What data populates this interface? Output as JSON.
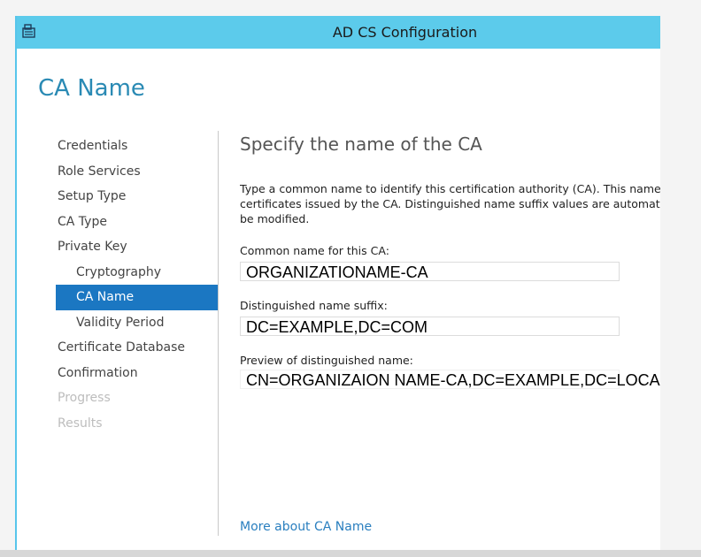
{
  "window": {
    "title": "AD CS Configuration",
    "app_icon": "server-icon"
  },
  "page": {
    "title": "CA Name"
  },
  "nav": {
    "items": [
      {
        "label": "Credentials",
        "state": "normal"
      },
      {
        "label": "Role Services",
        "state": "normal"
      },
      {
        "label": "Setup Type",
        "state": "normal"
      },
      {
        "label": "CA Type",
        "state": "normal"
      },
      {
        "label": "Private Key",
        "state": "normal"
      },
      {
        "label": "Cryptography",
        "state": "sub"
      },
      {
        "label": "CA Name",
        "state": "selected"
      },
      {
        "label": "Validity Period",
        "state": "sub"
      },
      {
        "label": "Certificate Database",
        "state": "normal"
      },
      {
        "label": "Confirmation",
        "state": "normal"
      },
      {
        "label": "Progress",
        "state": "disabled"
      },
      {
        "label": "Results",
        "state": "disabled"
      }
    ]
  },
  "content": {
    "heading": "Specify the name of the CA",
    "description": "Type a common name to identify this certification authority (CA). This name\ncertificates issued by the CA. Distinguished name suffix values are automatic\nbe modified.",
    "common_name_label": "Common name for this CA:",
    "common_name_value": "ORGANIZATIONAME-CA",
    "dn_suffix_label": "Distinguished name suffix:",
    "dn_suffix_value": "DC=EXAMPLE,DC=COM",
    "preview_label": "Preview of distinguished name:",
    "preview_value": "CN=ORGANIZAION NAME-CA,DC=EXAMPLE,DC=LOCAL",
    "more_link": "More about CA Name"
  },
  "colors": {
    "title_bar": "#5ccbeb",
    "accent_text": "#2a8ab4",
    "selected_nav": "#1b77c2",
    "link": "#2a7fbf"
  }
}
